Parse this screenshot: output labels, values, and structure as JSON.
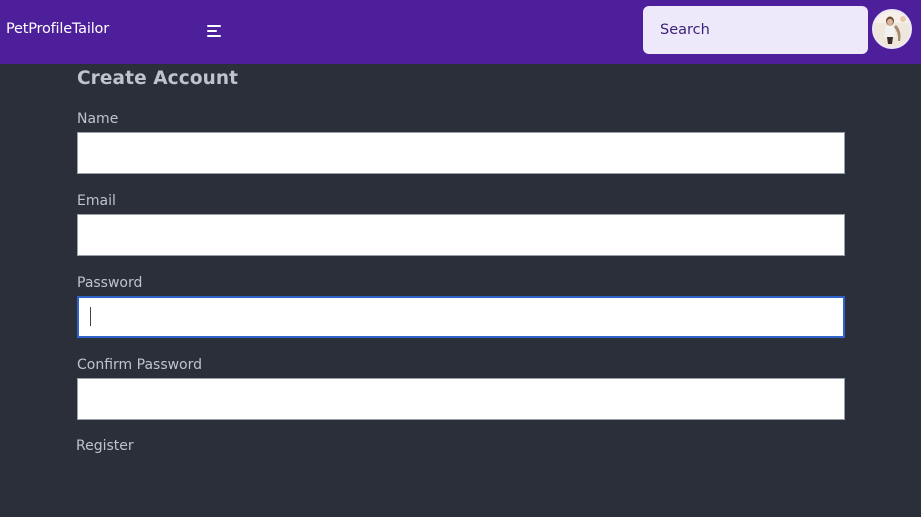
{
  "navbar": {
    "brand": "PetProfileTailor",
    "search_placeholder": "Search",
    "search_value": ""
  },
  "form": {
    "title": "Create Account",
    "fields": [
      {
        "label": "Name",
        "value": ""
      },
      {
        "label": "Email",
        "value": ""
      },
      {
        "label": "Password",
        "value": ""
      },
      {
        "label": "Confirm Password",
        "value": ""
      }
    ],
    "submit_label": "Register"
  },
  "colors": {
    "navbar": "#4e1f9a",
    "background": "#2a2f3a",
    "search_bg": "#ede8fa",
    "focus_border": "#2f63c9"
  },
  "icons": {
    "menu": "menu-icon",
    "avatar": "user-avatar"
  }
}
